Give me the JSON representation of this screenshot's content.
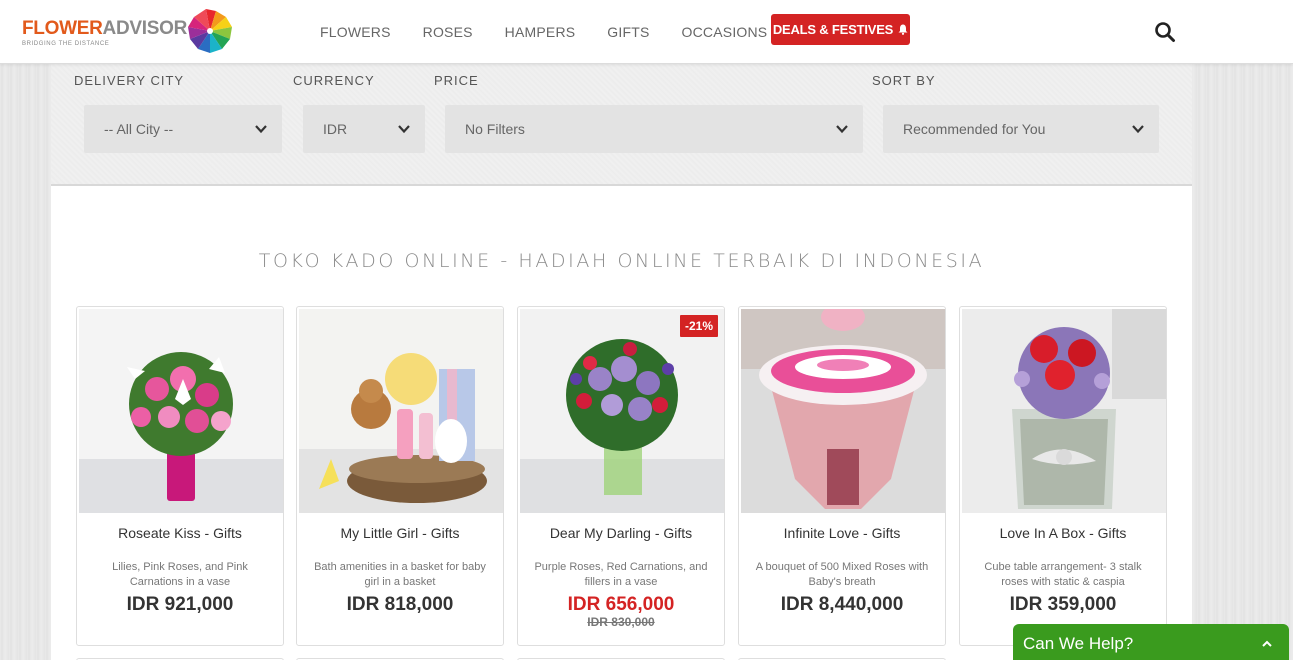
{
  "brand": {
    "logo_word1": "FLOWER",
    "logo_word2": "ADVISOR",
    "tagline": "BRIDGING THE DISTANCE"
  },
  "nav": {
    "items": [
      "FLOWERS",
      "ROSES",
      "HAMPERS",
      "GIFTS",
      "OCCASIONS"
    ],
    "deals_label": "DEALS & FESTIVES",
    "deals_icon": "bell-icon",
    "search_icon": "search-icon"
  },
  "filters": {
    "delivery_city": {
      "label": "DELIVERY CITY",
      "value": "-- All City --"
    },
    "currency": {
      "label": "CURRENCY",
      "value": "IDR"
    },
    "price": {
      "label": "PRICE",
      "value": "No Filters"
    },
    "sort_by": {
      "label": "SORT BY",
      "value": "Recommended for You"
    }
  },
  "page_title": "TOKO KADO ONLINE - HADIAH ONLINE TERBAIK DI INDONESIA",
  "products": [
    {
      "name": "Roseate Kiss - Gifts",
      "desc": "Lilies, Pink Roses, and Pink Carnations in a vase",
      "price": "IDR 921,000"
    },
    {
      "name": "My Little Girl - Gifts",
      "desc": "Bath amenities in a basket for baby girl in a basket",
      "price": "IDR 818,000"
    },
    {
      "name": "Dear My Darling - Gifts",
      "desc": "Purple Roses, Red Carnations, and fillers in a vase",
      "price": "IDR 656,000",
      "old_price": "IDR 830,000",
      "badge": "-21%"
    },
    {
      "name": "Infinite Love - Gifts",
      "desc": "A bouquet of 500 Mixed Roses with Baby's breath",
      "price": "IDR 8,440,000"
    },
    {
      "name": "Love In A Box - Gifts",
      "desc": "Cube table arrangement- 3 stalk roses with static & caspia",
      "price": "IDR 359,000"
    }
  ],
  "chat": {
    "label": "Can We Help?"
  },
  "colors": {
    "accent_red": "#d42323",
    "chat_green": "#3a9b1e",
    "logo_orange": "#e25a1c"
  }
}
